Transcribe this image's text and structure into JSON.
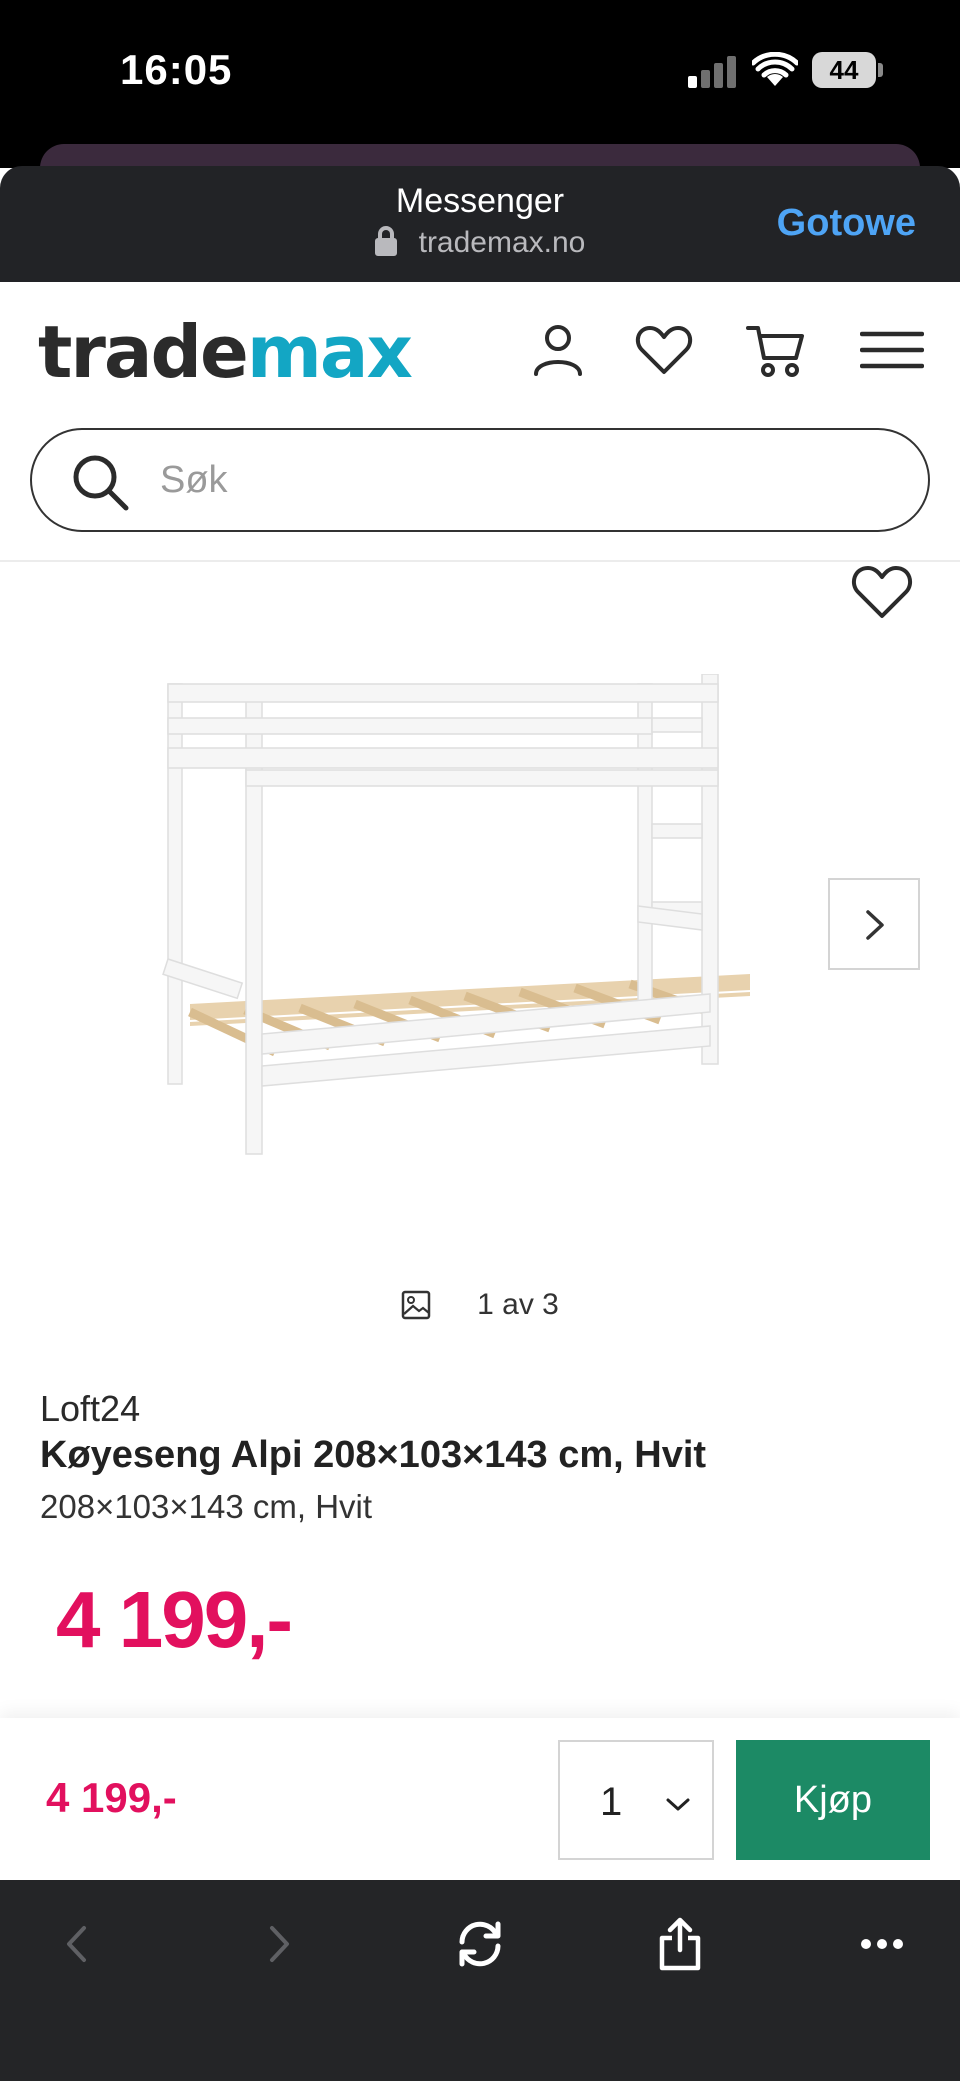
{
  "status_bar": {
    "time": "16:05",
    "battery": "44"
  },
  "sheet": {
    "title": "Messenger",
    "url": "trademax.no",
    "done_label": "Gotowe"
  },
  "site": {
    "logo_part1": "trade",
    "logo_part2": "max",
    "search_placeholder": "Søk",
    "icons": [
      "account-icon",
      "heart-icon",
      "cart-icon",
      "menu-icon"
    ]
  },
  "gallery": {
    "counter": "1 av 3"
  },
  "product": {
    "brand": "Loft24",
    "title": "Køyeseng Alpi 208×103×143 cm, Hvit",
    "subtitle": "208×103×143 cm, Hvit",
    "price": "4 199,-"
  },
  "buy_bar": {
    "price": "4 199,-",
    "quantity": "1",
    "buy_label": "Kjøp"
  },
  "colors": {
    "brand_teal": "#13a6c4",
    "price_pink": "#e2105e",
    "buy_green": "#1c8a65",
    "done_blue": "#4ea4f5"
  }
}
